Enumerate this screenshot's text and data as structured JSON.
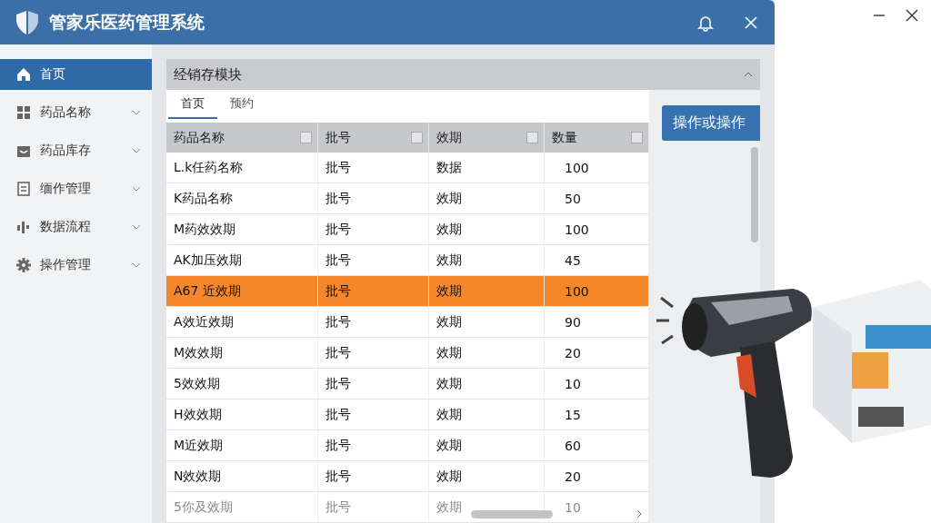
{
  "window": {
    "title": "管家乐医药管理系统"
  },
  "sidebar": {
    "items": [
      {
        "label": "首页",
        "selected": true,
        "expandable": false
      },
      {
        "label": "药品名称",
        "selected": false,
        "expandable": true
      },
      {
        "label": "药品库存",
        "selected": false,
        "expandable": true
      },
      {
        "label": "缅作管理",
        "selected": false,
        "expandable": true
      },
      {
        "label": "数据流程",
        "selected": false,
        "expandable": true
      },
      {
        "label": "操作管理",
        "selected": false,
        "expandable": true
      }
    ]
  },
  "panel": {
    "title": "经销存模块",
    "expanded": true
  },
  "tabs": [
    {
      "label": "首页",
      "selected": true
    },
    {
      "label": "预约",
      "selected": false
    }
  ],
  "table": {
    "columns": [
      "药品名称",
      "批号",
      "效期",
      "数量"
    ],
    "rows": [
      {
        "cells": [
          "L.k任药名称",
          "批号",
          "数据",
          "100"
        ],
        "selected": false,
        "dimmed": false
      },
      {
        "cells": [
          "K药品名称",
          "批号",
          "效期",
          "50"
        ],
        "selected": false,
        "dimmed": false
      },
      {
        "cells": [
          "M药效效期",
          "批号",
          "效期",
          "100"
        ],
        "selected": false,
        "dimmed": false
      },
      {
        "cells": [
          "AK加压效期",
          "批号",
          "效期",
          "45"
        ],
        "selected": false,
        "dimmed": false
      },
      {
        "cells": [
          "A67 近效期",
          "批号",
          "效期",
          "100"
        ],
        "selected": true,
        "dimmed": false
      },
      {
        "cells": [
          "A效近效期",
          "批号",
          "效期",
          "90"
        ],
        "selected": false,
        "dimmed": false
      },
      {
        "cells": [
          "M效效期",
          "批号",
          "效期",
          "20"
        ],
        "selected": false,
        "dimmed": false
      },
      {
        "cells": [
          "5效效期",
          "批号",
          "效期",
          "10"
        ],
        "selected": false,
        "dimmed": false
      },
      {
        "cells": [
          "H效效期",
          "批号",
          "效期",
          "15"
        ],
        "selected": false,
        "dimmed": false
      },
      {
        "cells": [
          "M近效期",
          "批号",
          "效期",
          "60"
        ],
        "selected": false,
        "dimmed": false
      },
      {
        "cells": [
          "N效效期",
          "批号",
          "效期",
          "20"
        ],
        "selected": false,
        "dimmed": false
      },
      {
        "cells": [
          "5你及效期",
          "批号",
          "效期",
          "10"
        ],
        "selected": false,
        "dimmed": true
      }
    ]
  },
  "action_button": "操作或操作"
}
